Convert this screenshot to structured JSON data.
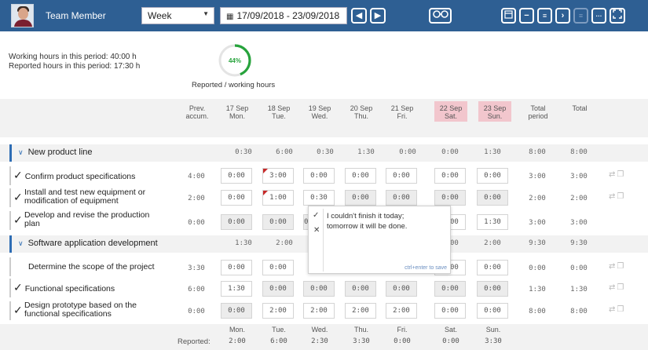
{
  "header": {
    "user_name": "Team Member",
    "period": "Week",
    "date_range": "17/09/2018 - 23/09/2018",
    "icons": [
      "calendar-icon",
      "prev-icon",
      "next-icon",
      "glasses-icon",
      "calendar-view-icon",
      "minus-icon",
      "list-icon",
      "chevron-right-icon",
      "menu-icon",
      "dots-icon",
      "expand-icon"
    ]
  },
  "summary": {
    "working_hours": "Working hours in this period: 40:00 h",
    "reported_hours": "Reported hours in this period: 17:30 h",
    "ring_percent": "44%",
    "ring_fraction": 0.44,
    "ring_label": "Reported / working hours"
  },
  "columns": {
    "prev": [
      "Prev.",
      "accum."
    ],
    "days": [
      {
        "date": "17 Sep",
        "day": "Mon."
      },
      {
        "date": "18 Sep",
        "day": "Tue."
      },
      {
        "date": "19 Sep",
        "day": "Wed."
      },
      {
        "date": "20 Sep",
        "day": "Thu."
      },
      {
        "date": "21 Sep",
        "day": "Fri."
      },
      {
        "date": "22 Sep",
        "day": "Sat."
      },
      {
        "date": "23 Sep",
        "day": "Sun."
      }
    ],
    "total_period": [
      "Total",
      "period"
    ],
    "total": "Total"
  },
  "groups": [
    {
      "label": "New product line",
      "days": [
        "0:30",
        "6:00",
        "0:30",
        "1:30",
        "0:00",
        "0:00",
        "1:30"
      ],
      "total_period": "8:00",
      "total": "8:00"
    },
    {
      "label": "Software application development",
      "days": [
        "1:30",
        "2:00"
      ],
      "days_right": [
        "0:00",
        "2:00"
      ],
      "total_period": "9:30",
      "total": "9:30"
    }
  ],
  "tasks": [
    {
      "label": "Confirm product specifications",
      "prev": "4:00",
      "days": [
        "0:00",
        "3:00",
        "0:00",
        "0:00",
        "0:00",
        "0:00",
        "0:00"
      ],
      "total_period": "3:00",
      "total": "3:00"
    },
    {
      "label": "Install and test new equipment or",
      "label2": "modification of equipment",
      "prev": "2:00",
      "days": [
        "0:00",
        "1:00",
        "0:30",
        "0:00",
        "0:00",
        "0:00",
        "0:00"
      ],
      "total_period": "2:00",
      "total": "2:00"
    },
    {
      "label": "Develop and revise the production",
      "label2": "plan",
      "prev": "0:00",
      "days": [
        "0:00",
        "0:00",
        "0:00",
        "",
        "",
        "0:00",
        "1:30"
      ],
      "total_period": "3:00",
      "total": "3:00"
    },
    {
      "label": "Determine the scope of the project",
      "prev": "3:30",
      "days": [
        "0:00",
        "0:00",
        "",
        "",
        "",
        "0:00",
        "0:00"
      ],
      "total_period": "0:00",
      "total": "0:00"
    },
    {
      "label": "Functional specifications",
      "prev": "6:00",
      "days": [
        "1:30",
        "0:00",
        "0:00",
        "0:00",
        "0:00",
        "0:00",
        "0:00"
      ],
      "total_period": "1:30",
      "total": "1:30"
    },
    {
      "label": "Design prototype based on the",
      "label2": "functional specifications",
      "prev": "0:00",
      "days": [
        "0:00",
        "2:00",
        "2:00",
        "2:00",
        "2:00",
        "0:00",
        "0:00"
      ],
      "total_period": "8:00",
      "total": "8:00"
    }
  ],
  "popup": {
    "message_line1": "I couldn't finish it today;",
    "message_line2": "tomorrow it will be done.",
    "hint": "ctrl+enter to save",
    "ok_icon": "check-icon",
    "cancel_icon": "close-icon"
  },
  "footer": {
    "label": "Reported:",
    "days": [
      "Mon.",
      "Tue.",
      "Wed.",
      "Thu.",
      "Fri.",
      "Sat.",
      "Sun."
    ],
    "values": [
      "2:00",
      "6:00",
      "2:30",
      "3:30",
      "0:00",
      "0:00",
      "3:30"
    ]
  },
  "colors": {
    "topbar": "#2e5f93",
    "accent_green": "#27a33c",
    "group_accent": "#2e6db4",
    "weekend": "#f2c6cd",
    "comment_flag": "#c62828"
  }
}
